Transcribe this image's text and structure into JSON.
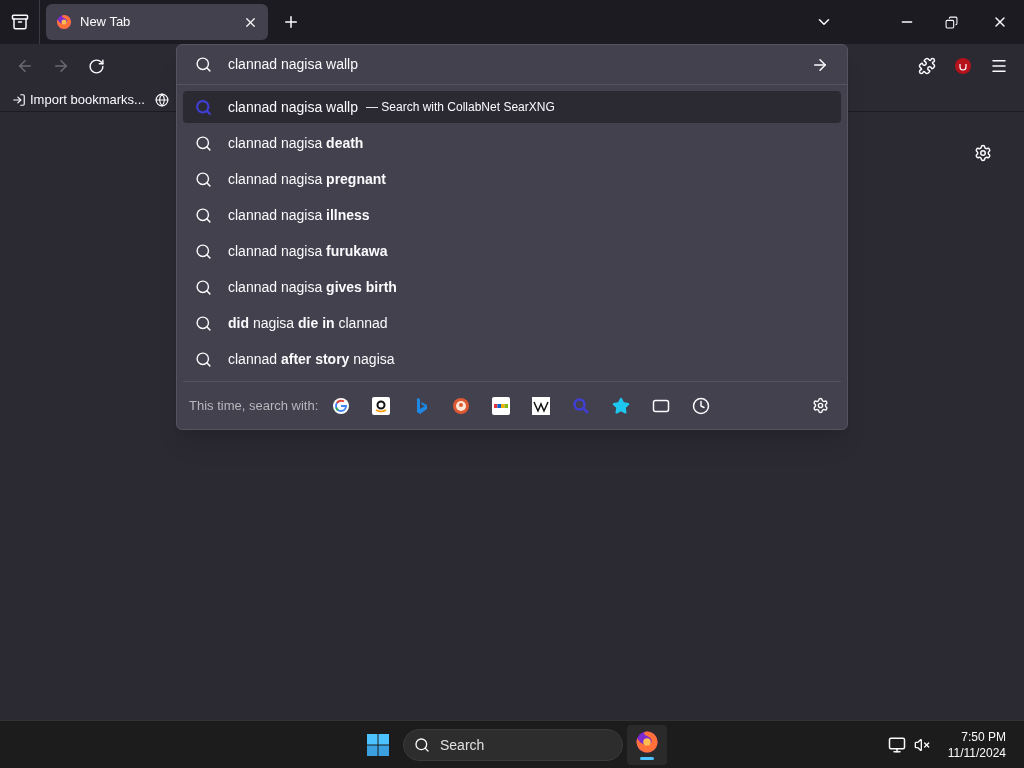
{
  "tabs": [
    {
      "title": "New Tab",
      "selected": true
    }
  ],
  "address_bar": {
    "value": "clannad nagisa wallp"
  },
  "bookmarks": [
    {
      "label": "Import bookmarks...",
      "kind": "import"
    },
    {
      "kind": "globe"
    }
  ],
  "suggestions": [
    {
      "text": "clannad nagisa wallp",
      "action": "— Search with CollabNet SearXNG",
      "kind": "engine",
      "selected": true
    },
    {
      "text": "clannad nagisa **death**",
      "kind": "suggestion",
      "selected": false
    },
    {
      "text": "clannad nagisa **pregnant**",
      "kind": "suggestion",
      "selected": false
    },
    {
      "text": "clannad nagisa **illness**",
      "kind": "suggestion",
      "selected": false
    },
    {
      "text": "clannad nagisa **furukawa**",
      "kind": "suggestion",
      "selected": false
    },
    {
      "text": "clannad nagisa **gives birth**",
      "kind": "suggestion",
      "selected": false
    },
    {
      "text": "**did** nagisa **die in** clannad",
      "kind": "suggestion",
      "selected": false
    },
    {
      "text": "clannad **after story** nagisa",
      "kind": "suggestion",
      "selected": false
    }
  ],
  "search_with": {
    "label": "This time, search with:",
    "engines": [
      {
        "kind": "google"
      },
      {
        "kind": "amazon"
      },
      {
        "kind": "bing"
      },
      {
        "kind": "duckduckgo"
      },
      {
        "kind": "ebay"
      },
      {
        "kind": "wikipedia"
      },
      {
        "kind": "searx"
      },
      {
        "kind": "bookmarks"
      },
      {
        "kind": "tabs"
      },
      {
        "kind": "history"
      }
    ]
  },
  "taskbar": {
    "search_placeholder": "Search",
    "time": "7:50 PM",
    "date": "11/11/2024"
  }
}
